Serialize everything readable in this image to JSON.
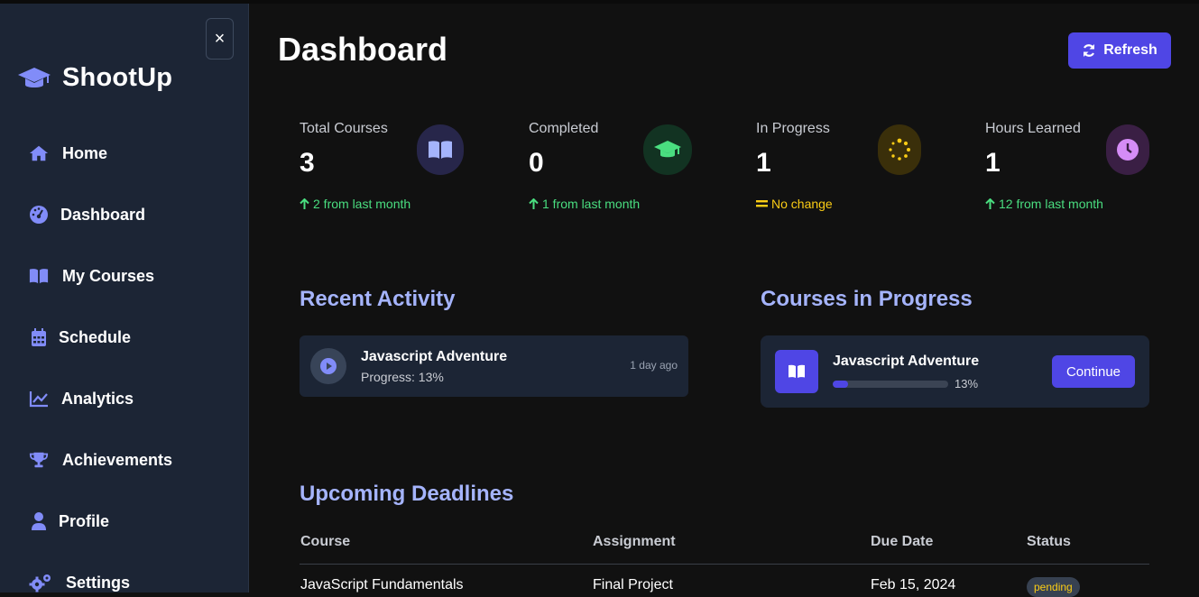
{
  "sidebar": {
    "brand": "ShootUp",
    "close_label": "×",
    "items": [
      {
        "label": "Home",
        "icon": "home-icon"
      },
      {
        "label": "Dashboard",
        "icon": "gauge-icon"
      },
      {
        "label": "My Courses",
        "icon": "book-icon"
      },
      {
        "label": "Schedule",
        "icon": "calendar-icon"
      },
      {
        "label": "Analytics",
        "icon": "chart-line-icon"
      },
      {
        "label": "Achievements",
        "icon": "trophy-icon"
      },
      {
        "label": "Profile",
        "icon": "user-icon"
      },
      {
        "label": "Settings",
        "icon": "cogs-icon"
      }
    ]
  },
  "header": {
    "title": "Dashboard",
    "refresh_label": "Refresh"
  },
  "stats": [
    {
      "label": "Total Courses",
      "value": "3",
      "change": "2 from last month",
      "trend": "up",
      "icon": "book-icon"
    },
    {
      "label": "Completed",
      "value": "0",
      "change": "1 from last month",
      "trend": "up",
      "icon": "graduation-cap-icon"
    },
    {
      "label": "In Progress",
      "value": "1",
      "change": "No change",
      "trend": "same",
      "icon": "spinner-icon"
    },
    {
      "label": "Hours Learned",
      "value": "1",
      "change": "12 from last month",
      "trend": "up",
      "icon": "clock-icon"
    }
  ],
  "recent_activity": {
    "title": "Recent Activity",
    "items": [
      {
        "title": "Javascript Adventure",
        "subtitle": "Progress: 13%",
        "time": "1 day ago"
      }
    ]
  },
  "courses_in_progress": {
    "title": "Courses in Progress",
    "items": [
      {
        "title": "Javascript Adventure",
        "progress": 13,
        "progress_label": "13%",
        "button": "Continue"
      }
    ]
  },
  "deadlines": {
    "title": "Upcoming Deadlines",
    "columns": [
      "Course",
      "Assignment",
      "Due Date",
      "Status"
    ],
    "rows": [
      {
        "course": "JavaScript Fundamentals",
        "assignment": "Final Project",
        "due": "Feb 15, 2024",
        "status": "pending"
      }
    ]
  },
  "colors": {
    "accent": "#4f46e5",
    "section_title": "#a5b4fc",
    "positive": "#4ade80",
    "neutral": "#facc15"
  }
}
